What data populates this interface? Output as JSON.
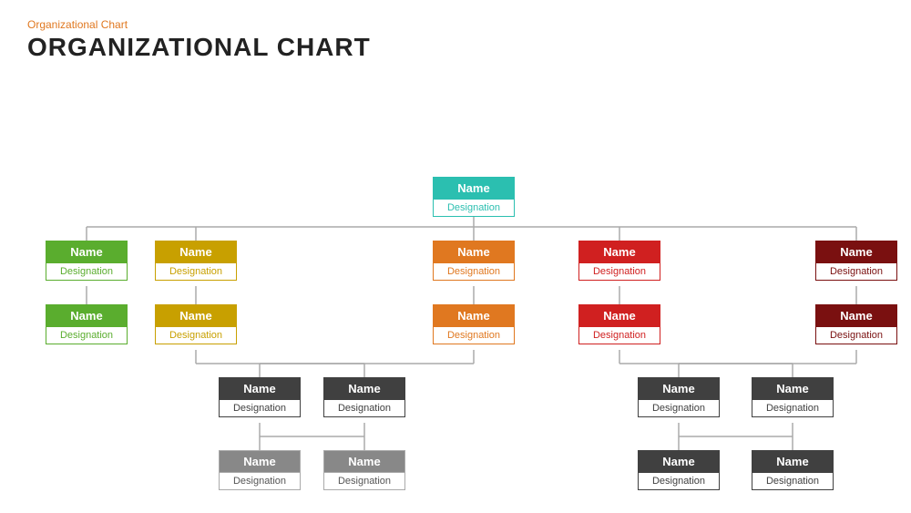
{
  "subtitle": "Organizational  Chart",
  "title": "ORGANIZATIONAL CHART",
  "nodes": {
    "root": {
      "name": "Name",
      "designation": "Designation"
    },
    "l1_green1": {
      "name": "Name",
      "designation": "Designation"
    },
    "l1_green2": {
      "name": "Name",
      "designation": "Designation"
    },
    "l1_yellow1": {
      "name": "Name",
      "designation": "Designation"
    },
    "l1_yellow2": {
      "name": "Name",
      "designation": "Designation"
    },
    "l1_orange1": {
      "name": "Name",
      "designation": "Designation"
    },
    "l1_orange2": {
      "name": "Name",
      "designation": "Designation"
    },
    "l1_red1": {
      "name": "Name",
      "designation": "Designation"
    },
    "l1_red2": {
      "name": "Name",
      "designation": "Designation"
    },
    "l1_darkred1": {
      "name": "Name",
      "designation": "Designation"
    },
    "l1_darkred2": {
      "name": "Name",
      "designation": "Designation"
    },
    "l2_dg1": {
      "name": "Name",
      "designation": "Designation"
    },
    "l2_dg2": {
      "name": "Name",
      "designation": "Designation"
    },
    "l2_dg3": {
      "name": "Name",
      "designation": "Designation"
    },
    "l2_dg4": {
      "name": "Name",
      "designation": "Designation"
    },
    "l3_lg1": {
      "name": "Name",
      "designation": "Designation"
    },
    "l3_lg2": {
      "name": "Name",
      "designation": "Designation"
    },
    "l3_lg3": {
      "name": "Name",
      "designation": "Designation"
    },
    "l3_lg4": {
      "name": "Name",
      "designation": "Designation"
    }
  }
}
